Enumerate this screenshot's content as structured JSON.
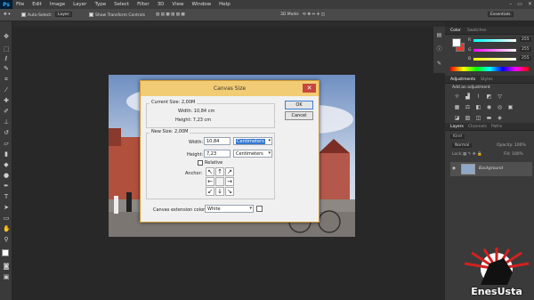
{
  "app": {
    "logo": "Ps"
  },
  "menu": [
    "File",
    "Edit",
    "Image",
    "Layer",
    "Type",
    "Select",
    "Filter",
    "3D",
    "View",
    "Window",
    "Help"
  ],
  "window_controls": [
    "–",
    "▭",
    "✕"
  ],
  "options_bar": {
    "auto_select": "Auto-Select:",
    "layer_value": "Layer",
    "show_transform": "Show Transform Controls",
    "mode_3d": "3D Mode:",
    "workspace": "Essentials"
  },
  "dialog": {
    "title": "Canvas Size",
    "close": "✕",
    "current_group": "Current Size: 2,00M",
    "current_width": "Width:  10,84 cm",
    "current_height": "Height:  7,23 cm",
    "new_group": "New Size: 2,00M",
    "width_label": "Width:",
    "width_value": "10,84",
    "width_unit": "Centimeters",
    "height_label": "Height:",
    "height_value": "7,23",
    "height_unit": "Centimeters",
    "relative": "Relative",
    "anchor": "Anchor:",
    "anchor_arrows": [
      "↖",
      "↑",
      "↗",
      "←",
      "",
      "→",
      "↙",
      "↓",
      "↘"
    ],
    "ext_label": "Canvas extension color:",
    "ext_value": "White",
    "ok": "OK",
    "cancel": "Cancel"
  },
  "panels": {
    "color_tabs": [
      "Color",
      "Swatches"
    ],
    "color_channels": [
      "R",
      "G",
      "B"
    ],
    "color_values": [
      "255",
      "255",
      "255"
    ],
    "adj_tabs": [
      "Adjustments",
      "Styles"
    ],
    "adj_add": "Add an adjustment",
    "layers_tabs": [
      "Layers",
      "Channels",
      "Paths"
    ],
    "blend_mode": "Normal",
    "opacity": "Opacity: 100%",
    "lock": "Lock:",
    "fill": "Fill: 100%",
    "kind": "Kind",
    "layer_name": "Background"
  },
  "watermark": "EnesUsta",
  "colors": {
    "fg": "#ffffff",
    "bg": "#e23a2a",
    "accent": "#f2cc74"
  }
}
